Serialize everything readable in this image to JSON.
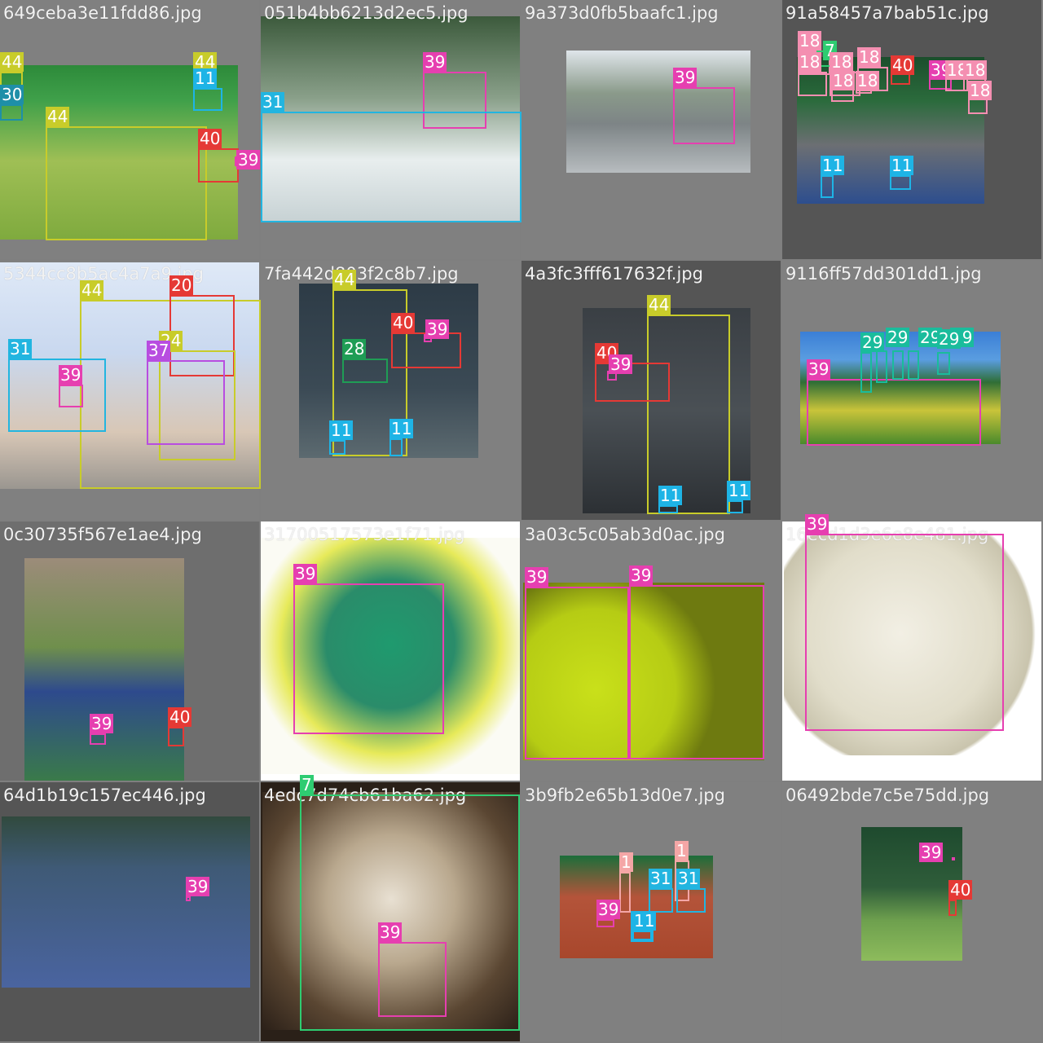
{
  "colors": {
    "background": "#7f7f7f",
    "classes": {
      "1": "#f4a6a6",
      "7": "#2ecc71",
      "11": "#1eb4e6",
      "18": "#f48fb1",
      "20": "#e53935",
      "24": "#c8cc2a",
      "28": "#1f9d55",
      "29": "#1abc9c",
      "30": "#1e8fa8",
      "31": "#22b5e0",
      "37": "#b84de0",
      "39": "#e63fb0",
      "40": "#e53935",
      "44": "#c8cc2a"
    }
  },
  "tiles": [
    {
      "filename": "649ceba3e11fdd86.jpg",
      "bg": "#808080",
      "photo_bg": "linear-gradient(180deg,#2d8a3a 0%,#3fa04a 20%,#9fbf55 55%,#7faa3e 100%)",
      "labels": [
        {
          "cls": "44",
          "box": [
            0,
            0,
            0,
            0
          ]
        }
      ]
    },
    {
      "filename": "051b4bb6213d2ec5.jpg",
      "bg": "#808080",
      "photo_bg": "linear-gradient(180deg,#3c5a3c 0%,#8aa08a 40%,#e8eeee 70%,#c7d2d4 100%)"
    },
    {
      "filename": "9a373d0fb5baafc1.jpg",
      "bg": "#808080",
      "photo_bg": "linear-gradient(180deg,#dfe5ea 0%,#8a9a8a 35%,#7d8486 60%,#b7bcbf 100%)"
    },
    {
      "filename": "91a58457a7bab51c.jpg",
      "bg": "#555555",
      "photo_bg": "linear-gradient(180deg,#1b4e2c 0%,#2b6b3c 30%,#6c6f73 60%,#2d4e8e 100%)"
    },
    {
      "filename": "5344cc8b5ac4a7a9.jpg",
      "bg": "#808080",
      "photo_bg": "linear-gradient(180deg,#dfe9f7 0%,#c9d8ef 40%,#d8c7b6 75%,#9a9690 100%)"
    },
    {
      "filename": "7fa442d803f2c8b7.jpg",
      "bg": "#808080",
      "photo_bg": "linear-gradient(180deg,#2d3b46 0%,#3b4a55 60%,#5c6a70 100%)"
    },
    {
      "filename": "4a3fc3fff617632f.jpg",
      "bg": "#555555",
      "photo_bg": "linear-gradient(180deg,#3a3f44 0%,#4a5055 50%,#2c3034 100%)"
    },
    {
      "filename": "9116ff57dd301dd1.jpg",
      "bg": "#808080",
      "photo_bg": "linear-gradient(180deg,#3b7fd6 0%,#5a9de0 25%,#2f6e36 45%,#c9c43a 70%,#4a8a2c 100%)"
    },
    {
      "filename": "0c30735f567e1ae4.jpg",
      "bg": "#6e6e6e",
      "photo_bg": "linear-gradient(180deg,#9c8c7a 0%,#6f8f4c 40%,#2e4a8d 60%,#3a7a4a 100%)"
    },
    {
      "filename": "31700517573e1f71.jpg",
      "bg": "#ffffff",
      "photo_bg": "radial-gradient(circle at 50% 45%,#1f9a6e 0%,#2a8c6a 35%,#e7ea5a 60%,#fbfbf4 75%)"
    },
    {
      "filename": "3a03c5c05ab3d0ac.jpg",
      "bg": "#808080",
      "photo_bg": "radial-gradient(circle at 30% 60%,#c9e01a 0%,#b6cc14 40%,#6e7a10 60%),linear-gradient(90deg,#d8e21a,#eef318)"
    },
    {
      "filename": "16ecd1d3e6e8e481.jpg",
      "bg": "#ffffff",
      "photo_bg": "radial-gradient(circle at 45% 45%,#f2efe4 0%,#e1ddca 50%,#c9c4ad 70%,#ffffff 72%)"
    },
    {
      "filename": "64d1b19c157ec446.jpg",
      "bg": "#555555",
      "photo_bg": "linear-gradient(180deg,#314a3e 0%,#3f5a76 30%,#4a64a0 100%)"
    },
    {
      "filename": "4edc7d74cb61ba62.jpg",
      "bg": "#2a2018",
      "photo_bg": "radial-gradient(circle at 50% 45%,#e8e0d2 0%,#b9a88e 35%,#5a4632 70%,#2b2018 100%)"
    },
    {
      "filename": "3b9fb2e65b13d0e7.jpg",
      "bg": "#808080",
      "photo_bg": "linear-gradient(180deg,#1c6e3a 0%,#b4543a 40%,#a8472c 100%)"
    },
    {
      "filename": "06492bde7c5e75dd.jpg",
      "bg": "#808080",
      "photo_bg": "linear-gradient(180deg,#1e4a2e 0%,#2f5d3a 45%,#6ea04e 70%,#8dbb5c 100%)"
    }
  ],
  "detections": [
    [
      {
        "cls": "44"
      },
      {
        "cls": "44"
      },
      {
        "cls": "30"
      },
      {
        "cls": "11"
      },
      {
        "cls": "44"
      },
      {
        "cls": "40"
      },
      {
        "cls": "39"
      }
    ],
    [
      {
        "cls": "39"
      },
      {
        "cls": "31"
      }
    ],
    [
      {
        "cls": "39"
      }
    ],
    [
      {
        "cls": "18"
      },
      {
        "cls": "7"
      },
      {
        "cls": "18"
      },
      {
        "cls": "18"
      },
      {
        "cls": "18"
      },
      {
        "cls": "40"
      },
      {
        "cls": "39"
      },
      {
        "cls": "18"
      },
      {
        "cls": "18"
      },
      {
        "cls": "18"
      },
      {
        "cls": "18"
      },
      {
        "cls": "18"
      },
      {
        "cls": "11"
      },
      {
        "cls": "11"
      }
    ],
    [
      {
        "cls": "44"
      },
      {
        "cls": "20"
      },
      {
        "cls": "24"
      },
      {
        "cls": "37"
      },
      {
        "cls": "31"
      },
      {
        "cls": "39"
      }
    ],
    [
      {
        "cls": "44"
      },
      {
        "cls": "40"
      },
      {
        "cls": "39"
      },
      {
        "cls": "28"
      },
      {
        "cls": "11"
      },
      {
        "cls": "11"
      }
    ],
    [
      {
        "cls": "44"
      },
      {
        "cls": "40"
      },
      {
        "cls": "39"
      },
      {
        "cls": "11"
      },
      {
        "cls": "11"
      }
    ],
    [
      {
        "cls": "39"
      },
      {
        "cls": "29"
      },
      {
        "cls": "29"
      },
      {
        "cls": "29"
      },
      {
        "cls": "29"
      },
      {
        "cls": "29"
      }
    ],
    [
      {
        "cls": "39"
      },
      {
        "cls": "40"
      }
    ],
    [
      {
        "cls": "39"
      }
    ],
    [
      {
        "cls": "39"
      },
      {
        "cls": "39"
      }
    ],
    [
      {
        "cls": "39"
      }
    ],
    [
      {
        "cls": "39"
      }
    ],
    [
      {
        "cls": "7"
      },
      {
        "cls": "39"
      }
    ],
    [
      {
        "cls": "1"
      },
      {
        "cls": "1"
      },
      {
        "cls": "31"
      },
      {
        "cls": "31"
      },
      {
        "cls": "11"
      },
      {
        "cls": "39"
      },
      {
        "cls": "11"
      }
    ],
    [
      {
        "cls": "39"
      },
      {
        "cls": "40"
      }
    ]
  ]
}
